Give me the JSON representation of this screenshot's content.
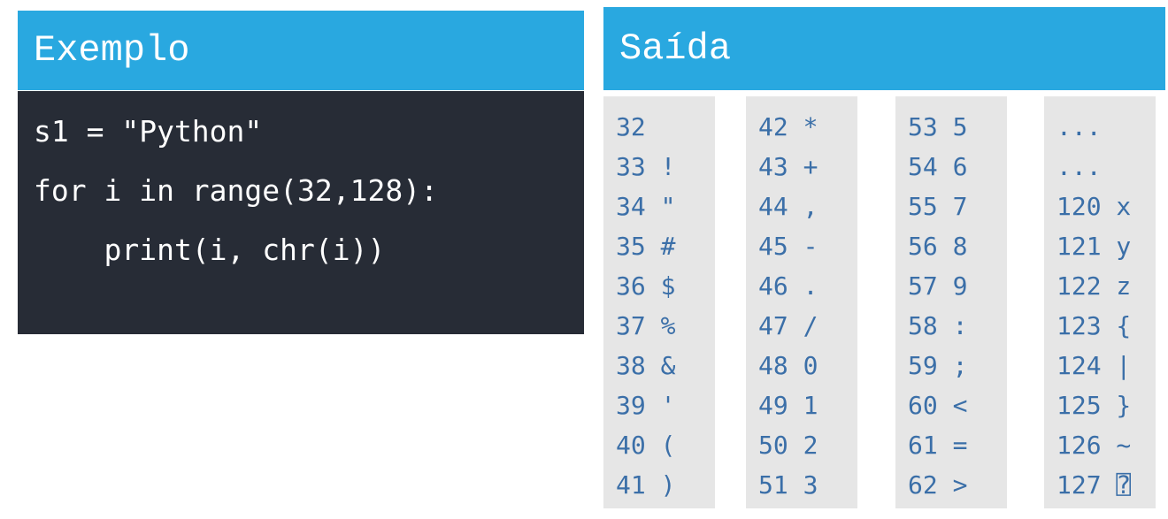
{
  "example": {
    "title": "Exemplo",
    "code_lines": [
      "s1 = \"Python\"",
      "for i in range(32,128):",
      "    print(i, chr(i))"
    ]
  },
  "output": {
    "title": "Saída",
    "columns": [
      [
        "32",
        "33 !",
        "34 \"",
        "35 #",
        "36 $",
        "37 %",
        "38 &",
        "39 '",
        "40 (",
        "41 )"
      ],
      [
        "42 *",
        "43 +",
        "44 ,",
        "45 -",
        "46 .",
        "47 /",
        "48 0",
        "49 1",
        "50 2",
        "51 3"
      ],
      [
        "53 5",
        "54 6",
        "55 7",
        "56 8",
        "57 9",
        "58 :",
        "59 ;",
        "60 <",
        "61 =",
        "62 >"
      ],
      [
        "...",
        "...",
        "120 x",
        "121 y",
        "122 z",
        "123 {",
        "124 |",
        "125 }",
        "126 ~",
        "127 ⍰"
      ]
    ]
  },
  "colors": {
    "header_bg": "#29a8e0",
    "code_bg": "#272c36",
    "output_bg": "#e6e6e6",
    "output_text": "#3b6fa8"
  }
}
